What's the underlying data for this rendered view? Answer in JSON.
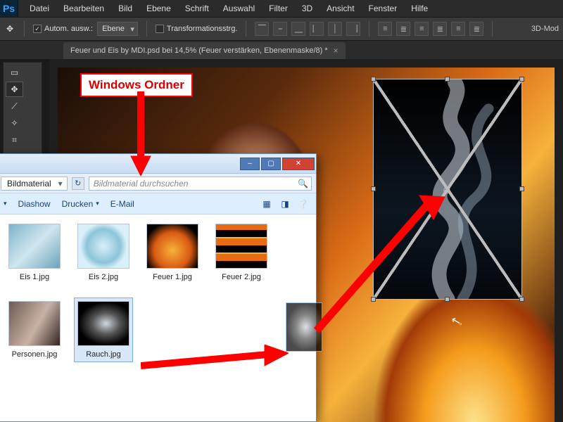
{
  "ps": {
    "logo": "Ps",
    "menu": [
      "Datei",
      "Bearbeiten",
      "Bild",
      "Ebene",
      "Schrift",
      "Auswahl",
      "Filter",
      "3D",
      "Ansicht",
      "Fenster",
      "Hilfe"
    ],
    "optbar": {
      "auto_select_label": "Autom. ausw.:",
      "auto_select_mode": "Ebene",
      "transform_toggle": "Transformationsstrg.",
      "threeD_mode": "3D-Mod"
    },
    "doc_tab": "Feuer und Eis by MDI.psd bei 14,5% (Feuer verstärken, Ebenenmaske/8) *"
  },
  "explorer": {
    "breadcrumb": "Bildmaterial",
    "search_placeholder": "Bildmaterial durchsuchen",
    "toolbar": {
      "slideshow": "Diashow",
      "print": "Drucken",
      "email": "E-Mail"
    },
    "files": [
      {
        "name": "Eis 1.jpg"
      },
      {
        "name": "Eis 2.jpg"
      },
      {
        "name": "Feuer 1.jpg"
      },
      {
        "name": "Feuer 2.jpg"
      },
      {
        "name": "Personen.jpg"
      },
      {
        "name": "Rauch.jpg"
      }
    ]
  },
  "annotations": {
    "folder_label": "Windows Ordner"
  }
}
